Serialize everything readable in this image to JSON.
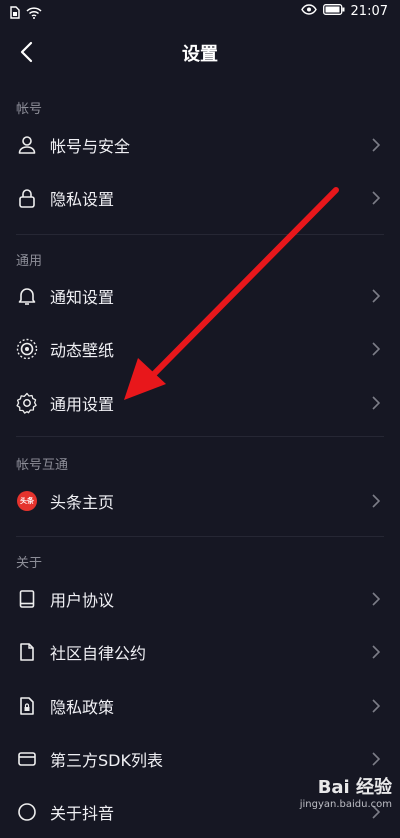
{
  "status_bar": {
    "time": "21:07",
    "icons": [
      "sim-icon",
      "wifi-icon",
      "eye-icon",
      "battery-icon"
    ]
  },
  "nav": {
    "title": "设置",
    "back_icon": "back-arrow-icon"
  },
  "sections": [
    {
      "label": "帐号",
      "items": [
        {
          "label": "帐号与安全",
          "icon": "user-icon"
        },
        {
          "label": "隐私设置",
          "icon": "lock-icon"
        }
      ]
    },
    {
      "label": "通用",
      "items": [
        {
          "label": "通知设置",
          "icon": "bell-icon"
        },
        {
          "label": "动态壁纸",
          "icon": "wallpaper-icon"
        },
        {
          "label": "通用设置",
          "icon": "gear-icon"
        }
      ]
    },
    {
      "label": "帐号互通",
      "items": [
        {
          "label": "头条主页",
          "icon": "toutiao-icon",
          "badge_text": "头条"
        }
      ]
    },
    {
      "label": "关于",
      "items": [
        {
          "label": "用户协议",
          "icon": "book-icon"
        },
        {
          "label": "社区自律公约",
          "icon": "document-icon"
        },
        {
          "label": "隐私政策",
          "icon": "lock-document-icon"
        },
        {
          "label": "第三方SDK列表",
          "icon": "card-icon"
        },
        {
          "label": "关于抖音",
          "icon": "info-icon"
        }
      ]
    }
  ],
  "colors": {
    "background": "#161723",
    "section_label": "#8d8e98",
    "arrow": "#e8171b"
  },
  "watermark": {
    "logo": "Bai 经验",
    "url": "jingyan.baidu.com"
  }
}
